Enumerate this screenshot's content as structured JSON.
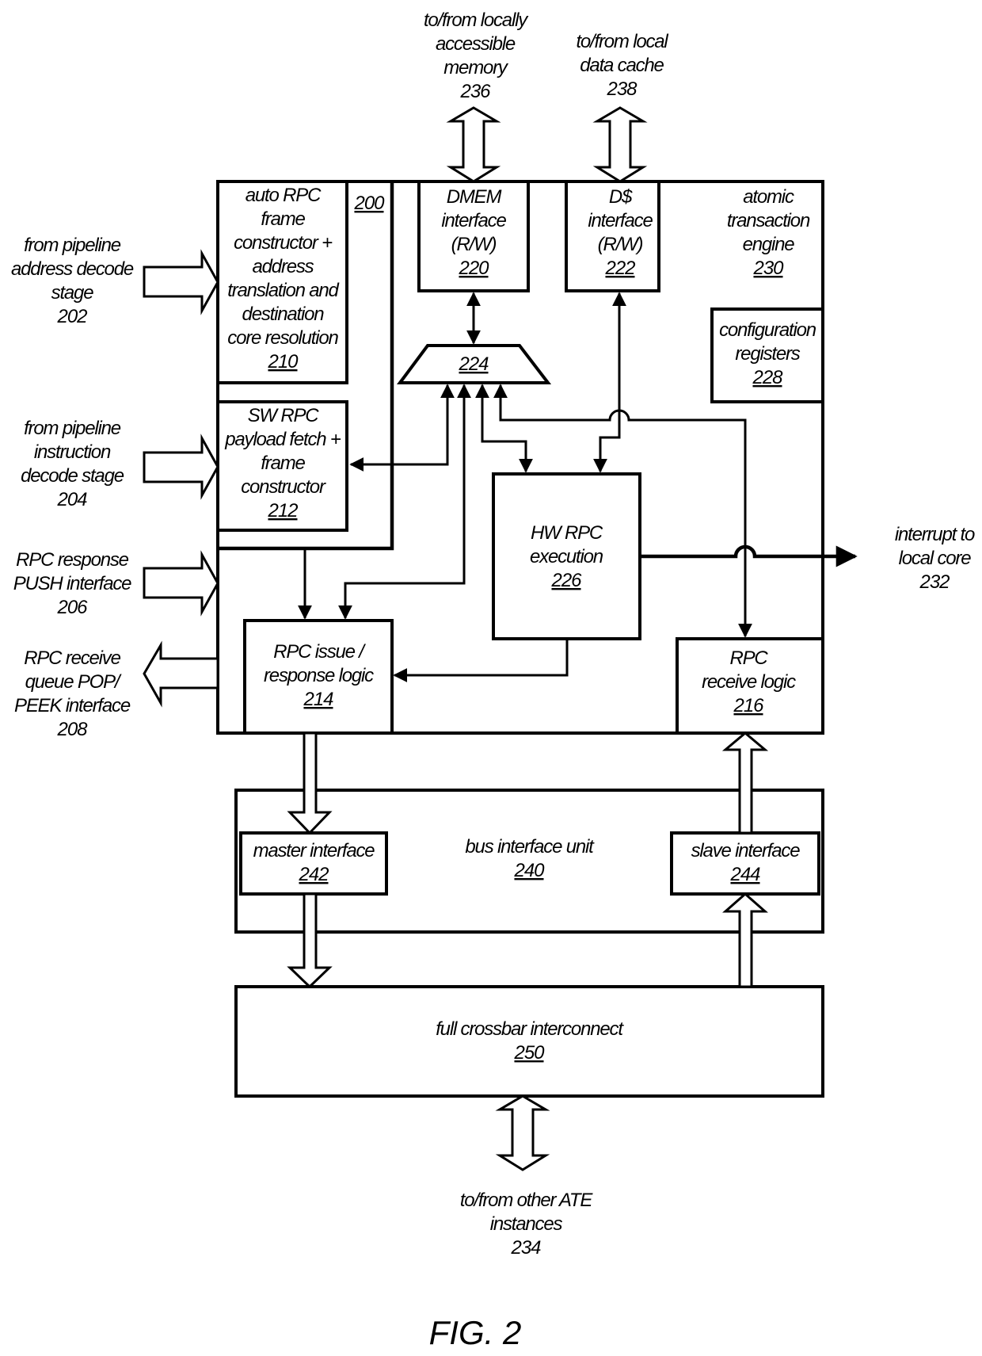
{
  "figure": {
    "caption": "FIG. 2"
  },
  "engine": {
    "ref": "200",
    "title_lines": [
      "atomic",
      "transaction",
      "engine"
    ],
    "title_ref": "230"
  },
  "blocks": {
    "auto_rpc": {
      "lines": [
        "auto RPC",
        "frame",
        "constructor +",
        "address",
        "translation and",
        "destination",
        "core resolution"
      ],
      "ref": "210"
    },
    "sw_rpc": {
      "lines": [
        "SW RPC",
        "payload fetch +",
        "frame",
        "constructor"
      ],
      "ref": "212"
    },
    "rpc_issue": {
      "lines": [
        "RPC issue /",
        "response logic"
      ],
      "ref": "214"
    },
    "rpc_receive": {
      "lines": [
        "RPC",
        "receive logic"
      ],
      "ref": "216"
    },
    "dmem": {
      "lines": [
        "DMEM",
        "interface",
        "(R/W)"
      ],
      "ref": "220"
    },
    "dcache": {
      "lines": [
        "D$",
        "interface",
        "(R/W)"
      ],
      "ref": "222"
    },
    "mux": {
      "ref": "224"
    },
    "hw_rpc": {
      "lines": [
        "HW RPC",
        "execution"
      ],
      "ref": "226"
    },
    "config": {
      "lines": [
        "configuration",
        "registers"
      ],
      "ref": "228"
    },
    "biu": {
      "lines": [
        "bus interface unit"
      ],
      "ref": "240"
    },
    "master": {
      "lines": [
        "master interface"
      ],
      "ref": "242"
    },
    "slave": {
      "lines": [
        "slave interface"
      ],
      "ref": "244"
    },
    "crossbar": {
      "lines": [
        "full crossbar interconnect"
      ],
      "ref": "250"
    }
  },
  "external": {
    "addr_decode": {
      "lines": [
        "from pipeline",
        "address decode",
        "stage"
      ],
      "ref": "202"
    },
    "instr_decode": {
      "lines": [
        "from pipeline",
        "instruction",
        "decode stage"
      ],
      "ref": "204"
    },
    "push": {
      "lines": [
        "RPC response",
        "PUSH interface"
      ],
      "ref": "206"
    },
    "pop": {
      "lines": [
        "RPC receive",
        "queue POP/",
        "PEEK interface"
      ],
      "ref": "208"
    },
    "interrupt": {
      "lines": [
        "interrupt to",
        "local core"
      ],
      "ref": "232"
    },
    "other_ate": {
      "lines": [
        "to/from other ATE",
        "instances"
      ],
      "ref": "234"
    },
    "memory": {
      "lines": [
        "to/from locally",
        "accessible",
        "memory"
      ],
      "ref": "236"
    },
    "data_cache": {
      "lines": [
        "to/from local",
        "data cache"
      ],
      "ref": "238"
    }
  }
}
